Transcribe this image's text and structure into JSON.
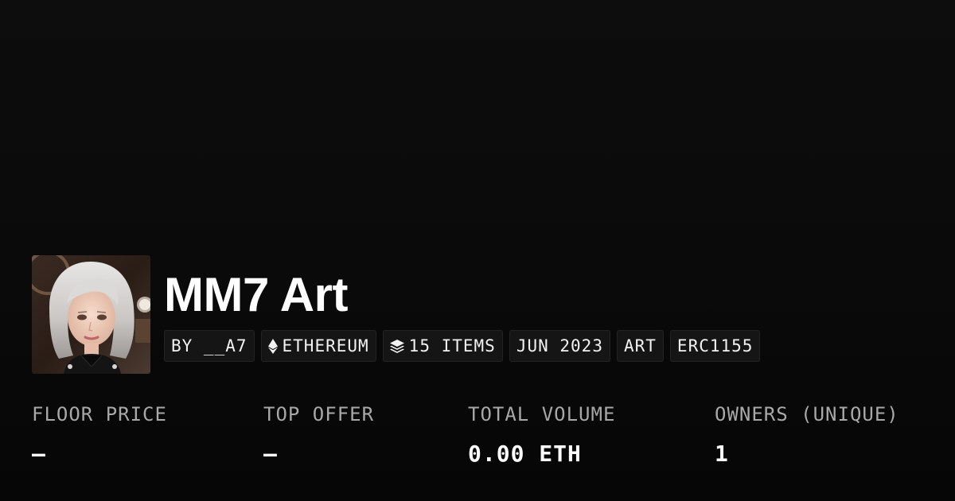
{
  "collection": {
    "title": "MM7 Art",
    "avatar_icon": "collection-avatar-portrait"
  },
  "tags": {
    "creator": "BY __A7",
    "chain": "ETHEREUM",
    "chain_icon": "ethereum-icon",
    "items": "15 ITEMS",
    "items_icon": "layers-icon",
    "date": "JUN 2023",
    "category": "ART",
    "standard": "ERC1155"
  },
  "stats": {
    "floor_price": {
      "label": "FLOOR PRICE",
      "value": "—"
    },
    "top_offer": {
      "label": "TOP OFFER",
      "value": "—"
    },
    "total_volume": {
      "label": "TOTAL VOLUME",
      "value": "0.00 ETH"
    },
    "owners": {
      "label": "OWNERS (UNIQUE)",
      "value": "1"
    }
  },
  "colors": {
    "background": "#0b0b0b",
    "tag_background": "#151515",
    "label_text": "#a8a8a8",
    "value_text": "#ffffff"
  }
}
